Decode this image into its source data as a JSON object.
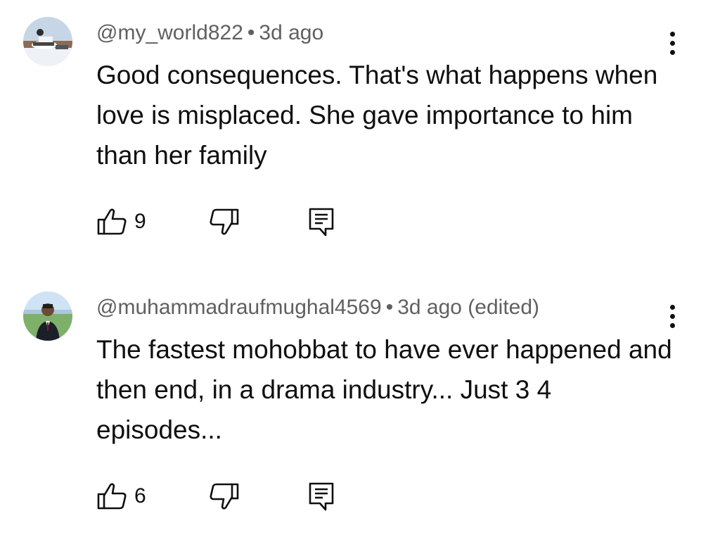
{
  "comments": [
    {
      "author": "@my_world822",
      "separator": "•",
      "time": "3d ago",
      "text": "Good consequences. That's what happens when love is misplaced. She gave importance to him than her family",
      "likes": "9",
      "icons": {
        "like": "thumbs-up-icon",
        "dislike": "thumbs-down-icon",
        "reply": "reply-icon",
        "menu": "more-vert-icon"
      }
    },
    {
      "author": "@muhammadraufmughal4569",
      "separator": "•",
      "time": "3d ago (edited)",
      "text": "The fastest mohobbat to have ever happened and then end, in a drama industry... Just 3 4 episodes...",
      "likes": "6",
      "icons": {
        "like": "thumbs-up-icon",
        "dislike": "thumbs-down-icon",
        "reply": "reply-icon",
        "menu": "more-vert-icon"
      }
    }
  ],
  "colors": {
    "text": "#0f0f0f",
    "meta": "#606060",
    "background": "#ffffff"
  }
}
